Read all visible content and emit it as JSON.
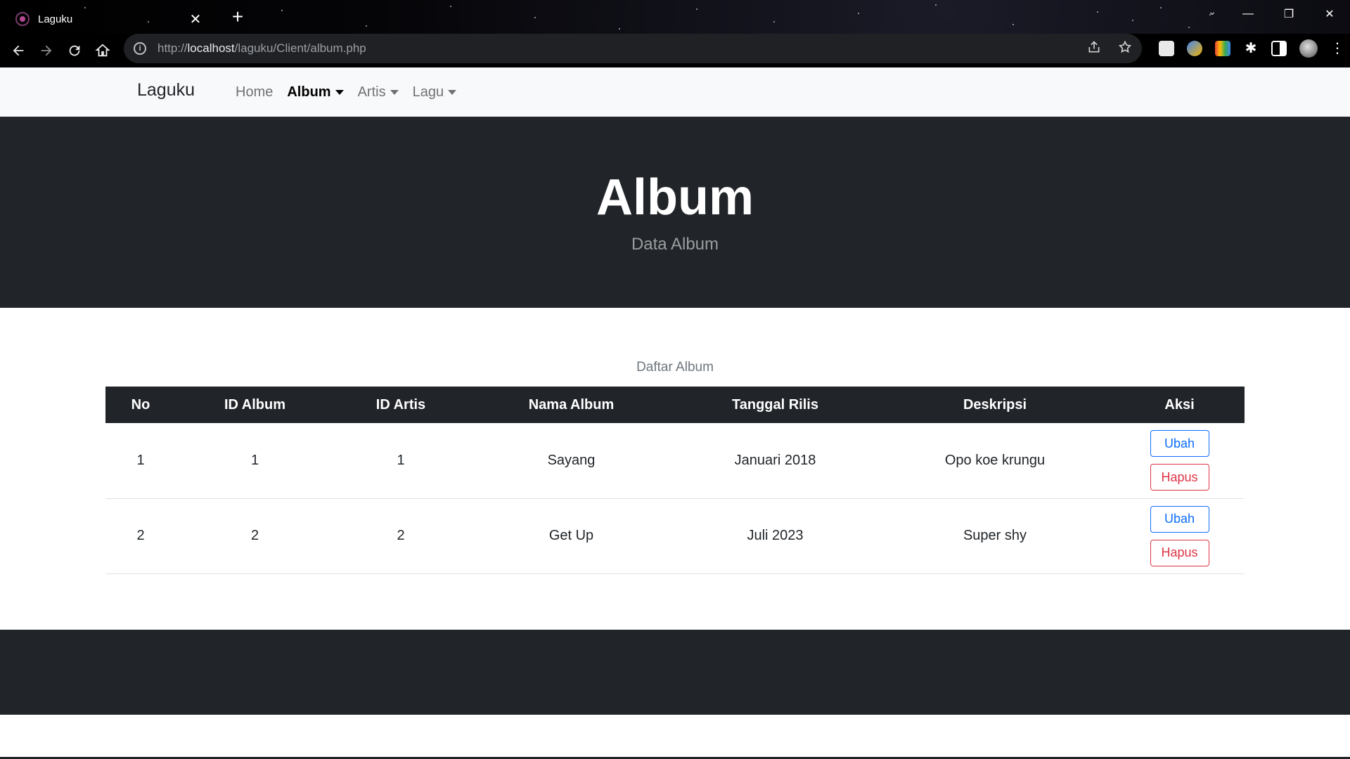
{
  "browser": {
    "tab_title": "Laguku",
    "tab_close": "✕",
    "new_tab": "+",
    "url_scheme": "http://",
    "url_host": "localhost",
    "url_path": "/laguku/Client/album.php",
    "window_controls": {
      "minimize": "—",
      "restore": "❐",
      "close": "✕"
    },
    "tab_search": "⌄"
  },
  "navbar": {
    "brand": "Laguku",
    "links": [
      {
        "label": "Home",
        "dropdown": false
      },
      {
        "label": "Album",
        "dropdown": true,
        "active": true
      },
      {
        "label": "Artis",
        "dropdown": true
      },
      {
        "label": "Lagu",
        "dropdown": true
      }
    ]
  },
  "hero": {
    "title": "Album",
    "subtitle": "Data Album"
  },
  "table": {
    "caption": "Daftar Album",
    "headers": [
      "No",
      "ID Album",
      "ID Artis",
      "Nama Album",
      "Tanggal Rilis",
      "Deskripsi",
      "Aksi"
    ],
    "rows": [
      {
        "no": "1",
        "id_album": "1",
        "id_artis": "1",
        "nama_album": "Sayang",
        "tanggal_rilis": "Januari 2018",
        "deskripsi": "Opo koe krungu",
        "edit_label": "Ubah",
        "delete_label": "Hapus"
      },
      {
        "no": "2",
        "id_album": "2",
        "id_artis": "2",
        "nama_album": "Get Up",
        "tanggal_rilis": "Juli 2023",
        "deskripsi": "Super shy",
        "edit_label": "Ubah",
        "delete_label": "Hapus"
      }
    ]
  },
  "colors": {
    "navbar_bg": "#f8f9fa",
    "dark": "#212529",
    "primary": "#0d6efd",
    "danger": "#dc3545"
  }
}
